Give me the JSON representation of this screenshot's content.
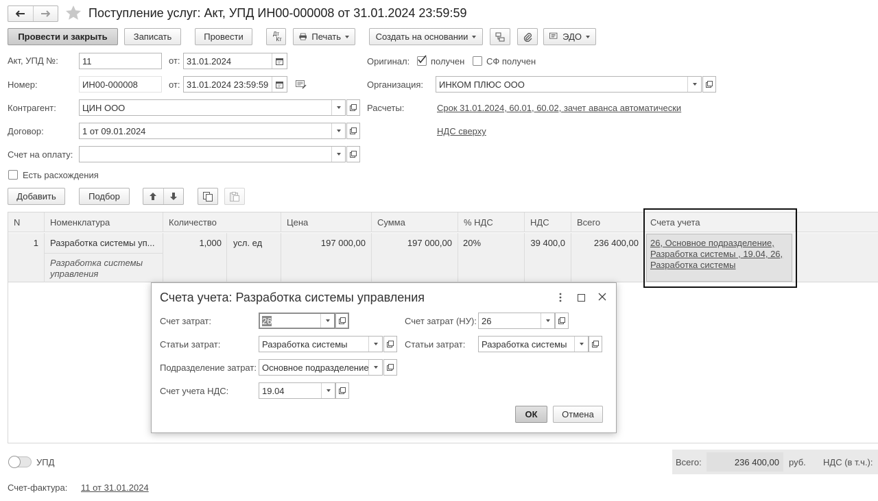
{
  "window": {
    "title": "Поступление услуг: Акт, УПД ИН00-000008 от 31.01.2024 23:59:59"
  },
  "toolbar": {
    "post_close": "Провести и закрыть",
    "save": "Записать",
    "post": "Провести",
    "dtkt_top": "Дт",
    "dtkt_bottom": "Кт",
    "print": "Печать",
    "create_based": "Создать на основании",
    "edo": "ЭДО"
  },
  "header": {
    "act_label": "Акт, УПД №:",
    "act_value": "11",
    "from_label": "от:",
    "act_date": "31.01.2024",
    "number_label": "Номер:",
    "number_value": "ИН00-000008",
    "number_date": "31.01.2024 23:59:59",
    "counterparty_label": "Контрагент:",
    "counterparty_value": "ЦИН ООО",
    "contract_label": "Договор:",
    "contract_value": "1 от 09.01.2024",
    "invoice_pay_label": "Счет на оплату:",
    "invoice_pay_value": "",
    "discrepancy_label": "Есть расхождения",
    "original_label": "Оригинал:",
    "received_label": "получен",
    "sf_received_label": "СФ получен",
    "org_label": "Организация:",
    "org_value": "ИНКОМ ПЛЮС ООО",
    "settlements_label": "Расчеты:",
    "settlements_link": "Срок 31.01.2024, 60.01, 60.02, зачет аванса автоматически",
    "vat_link": "НДС сверху"
  },
  "tabletools": {
    "add": "Добавить",
    "pick": "Подбор"
  },
  "table": {
    "columns": [
      "N",
      "Номенклатура",
      "Количество",
      "Цена",
      "Сумма",
      "% НДС",
      "НДС",
      "Всего",
      "Счета учета"
    ],
    "row": {
      "n": "1",
      "nomenclature": "Разработка системы уп...",
      "nomenclature_desc_1": "Разработка системы",
      "nomenclature_desc_2": "управления",
      "quantity": "1,000",
      "unit": "усл. ед",
      "price": "197 000,00",
      "sum": "197 000,00",
      "vat_rate": "20%",
      "vat": "39 400,0",
      "total": "236 400,00",
      "accounts_1": "26, Основное подразделение,",
      "accounts_2": "Разработка системы , 19.04, 26,",
      "accounts_3": "Разработка системы"
    }
  },
  "modal": {
    "title": "Счета учета: Разработка системы управления",
    "cost_account_label": "Счет затрат:",
    "cost_account_value": "26",
    "cost_account_nu_label": "Счет затрат (НУ):",
    "cost_account_nu_value": "26",
    "cost_items_label": "Статьи затрат:",
    "cost_items_value": "Разработка системы",
    "cost_items_nu_label": "Статьи затрат:",
    "cost_items_nu_value": "Разработка системы",
    "division_label": "Подразделение затрат:",
    "division_value": "Основное подразделение",
    "vat_account_label": "Счет учета НДС:",
    "vat_account_value": "19.04",
    "ok": "ОК",
    "cancel": "Отмена"
  },
  "footer": {
    "upd_label": "УПД",
    "invoice_label": "Счет-фактура:",
    "invoice_link": "11 от 31.01.2024",
    "total_label": "Всего:",
    "total_value": "236 400,00",
    "currency": "руб.",
    "vat_label": "НДС (в т.ч.):"
  }
}
